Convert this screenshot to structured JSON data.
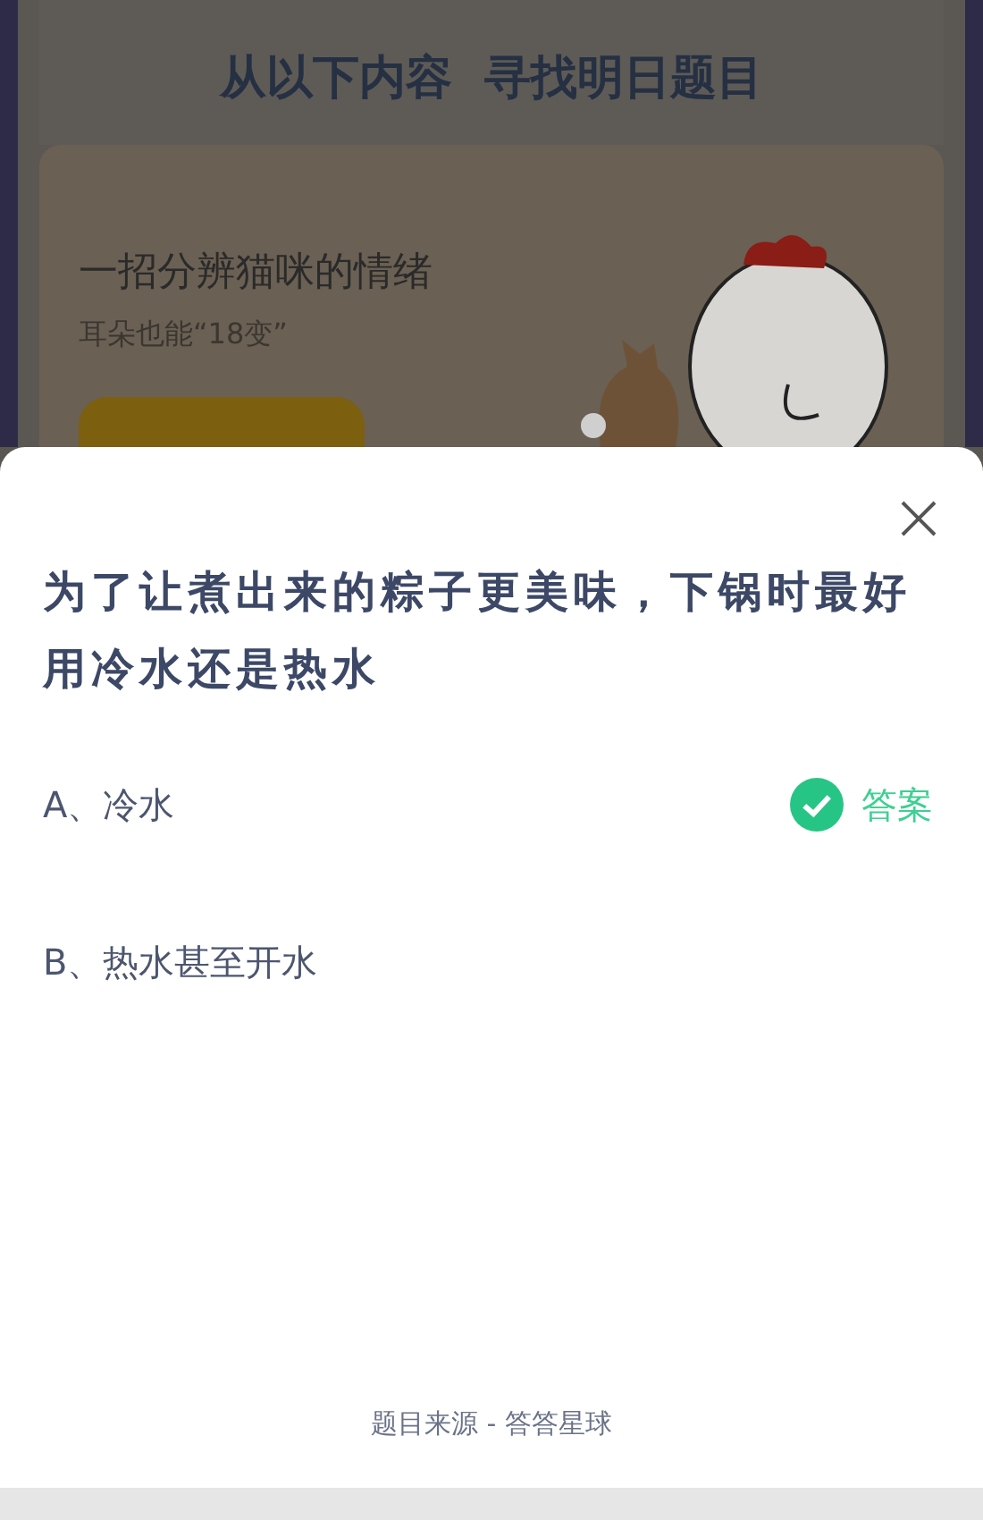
{
  "background": {
    "heading": "从以下内容  寻找明日题目",
    "card": {
      "title": "一招分辨猫咪的情绪",
      "subtitle": "耳朵也能“18变”"
    }
  },
  "sheet": {
    "question": "为了让煮出来的粽子更美味，下锅时最好用冷水还是热水",
    "answer_badge": "答案",
    "options": [
      {
        "label": "A、冷水",
        "correct": true
      },
      {
        "label": "B、热水甚至开水",
        "correct": false
      }
    ],
    "source": "题目来源 - 答答星球"
  }
}
